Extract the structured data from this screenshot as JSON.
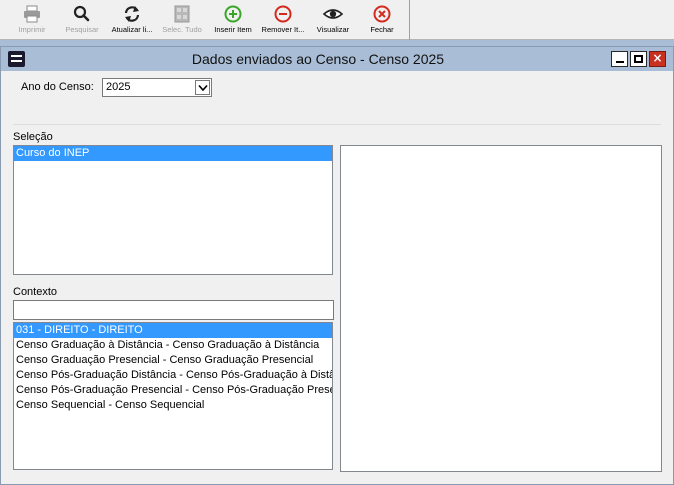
{
  "toolbar": {
    "buttons": [
      {
        "label": "Imprimir",
        "icon": "printer-icon",
        "enabled": false
      },
      {
        "label": "Pesquisar",
        "icon": "search-icon",
        "enabled": false
      },
      {
        "label": "Atualizar li...",
        "icon": "refresh-icon",
        "enabled": true
      },
      {
        "label": "Selec. Tudo",
        "icon": "select-all-icon",
        "enabled": false
      },
      {
        "label": "Inserir Item",
        "icon": "plus-circle-icon",
        "enabled": true,
        "color": "#3aa52a"
      },
      {
        "label": "Remover It...",
        "icon": "minus-circle-icon",
        "enabled": true,
        "color": "#d42a1e"
      },
      {
        "label": "Visualizar",
        "icon": "eye-icon",
        "enabled": true
      },
      {
        "label": "Fechar",
        "icon": "close-circle-icon",
        "enabled": true,
        "color": "#d42a1e"
      }
    ]
  },
  "window": {
    "title": "Dados enviados ao Censo - Censo 2025"
  },
  "form": {
    "ano_label": "Ano do Censo:",
    "ano_value": "2025",
    "selecao_label": "Seleção",
    "selecao_items": [
      "Curso do INEP"
    ],
    "contexto_label": "Contexto",
    "contexto_filter": "",
    "contexto_items": [
      "031 - DIREITO - DIREITO",
      "Censo Graduação à Distância - Censo Graduação à Distância",
      "Censo Graduação Presencial - Censo Graduação Presencial",
      "Censo Pós-Graduação Distância - Censo Pós-Graduação à Distância",
      "Censo Pós-Graduação Presencial - Censo Pós-Graduação Presencial",
      "Censo Sequencial - Censo Sequencial"
    ]
  },
  "colors": {
    "selection": "#3399ff",
    "titlebar": "#a9bed6",
    "close_button": "#c8311f"
  }
}
